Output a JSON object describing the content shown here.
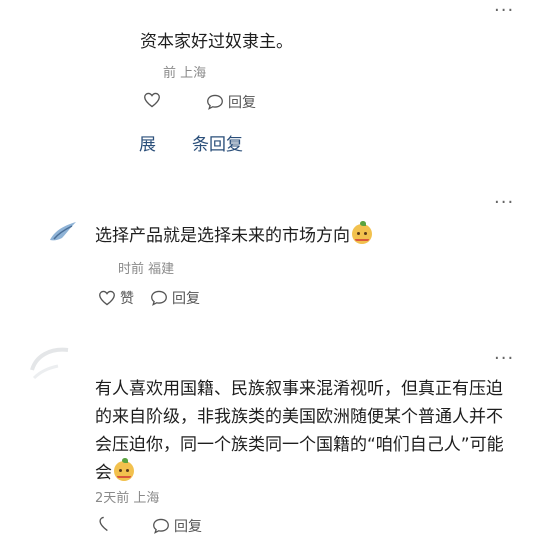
{
  "comments": [
    {
      "text": "资本家好过奴隶主。",
      "time": "前",
      "location": "上海",
      "reply_label": "回复",
      "expand_left": "展",
      "expand_right": "条回复",
      "more": "···"
    },
    {
      "text": "选择产品就是选择未来的市场方向",
      "emoji": "芒果表情",
      "time": "时前",
      "location": "福建",
      "like_label": "赞",
      "reply_label": "回复",
      "more": "···"
    },
    {
      "text_line1": "有人喜欢用国籍、民族叙事来混淆视听，但真正有压迫",
      "text_line2": "的来自阶级，非我族类的美国欧洲随便某个普通人并不",
      "text_line3": "会压迫你，同一个族类同一个国籍的“咱们自己人”可能",
      "text_line4": "会",
      "emoji": "芒果表情",
      "time": "2天前",
      "location": "上海",
      "reply_label": "回复",
      "more": "···"
    }
  ]
}
